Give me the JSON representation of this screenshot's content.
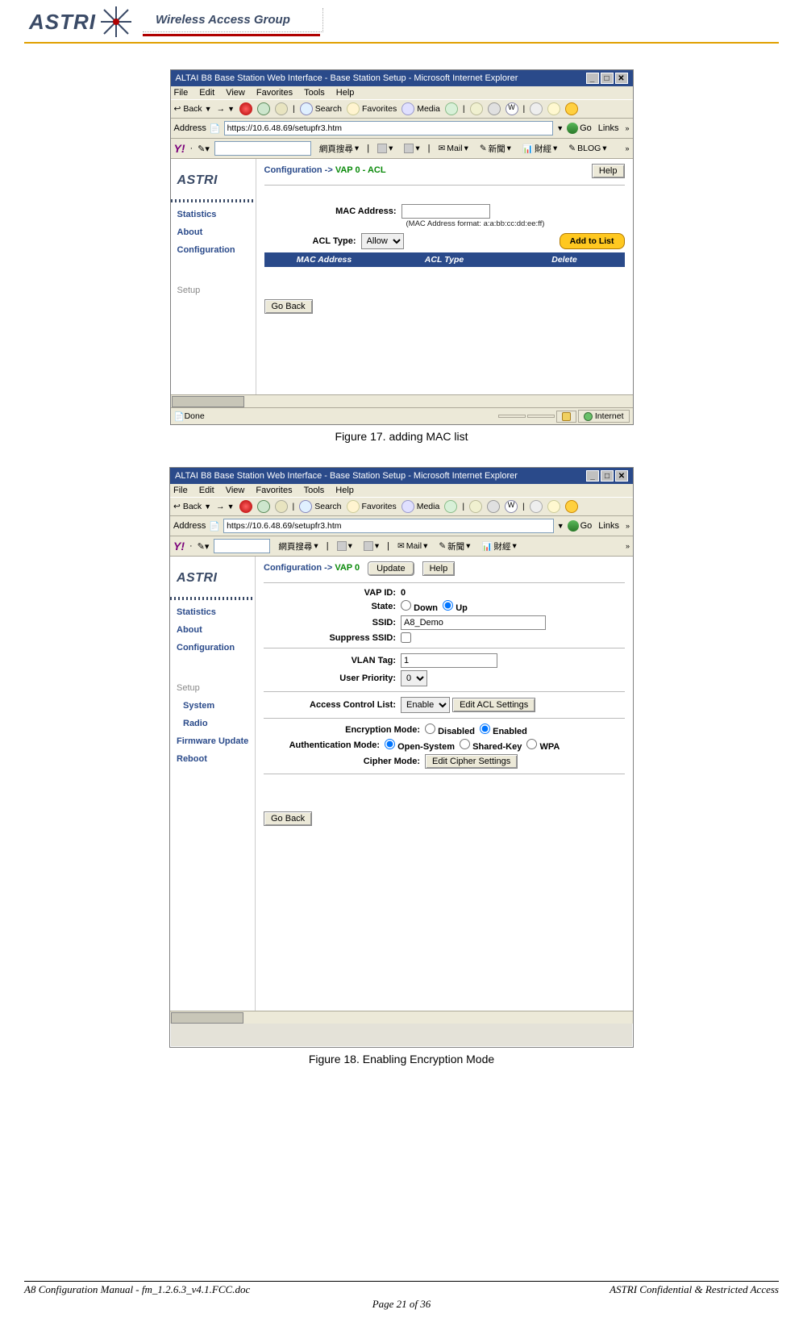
{
  "header": {
    "logo_text": "ASTRI",
    "wag_label": "Wireless Access Group"
  },
  "fig17": {
    "title": "ALTAI B8 Base Station Web Interface - Base Station Setup - Microsoft Internet Explorer",
    "menu": {
      "file": "File",
      "edit": "Edit",
      "view": "View",
      "favorites": "Favorites",
      "tools": "Tools",
      "help": "Help"
    },
    "toolbar": {
      "back": "Back",
      "search": "Search",
      "favorites": "Favorites",
      "media": "Media"
    },
    "address_label": "Address",
    "url": "https://10.6.48.69/setupfr3.htm",
    "go": "Go",
    "links": "Links",
    "yahoo": {
      "search": "網頁搜尋",
      "mail": "Mail",
      "news": "新聞",
      "fin": "財經",
      "blog": "BLOG"
    },
    "config_prefix": "Configuration ->",
    "config_page": "VAP 0 - ACL",
    "help": "Help",
    "mac_label": "MAC Address:",
    "mac_value": "",
    "mac_hint": "(MAC Address format: a:a:bb:cc:dd:ee:ff)",
    "acl_type_label": "ACL Type:",
    "acl_type_value": "Allow",
    "add_btn": "Add to List",
    "tbl": {
      "col1": "MAC Address",
      "col2": "ACL Type",
      "col3": "Delete"
    },
    "go_back": "Go Back",
    "sidebar": {
      "statistics": "Statistics",
      "about": "About",
      "configuration": "Configuration",
      "setup": "Setup"
    },
    "status_done": "Done",
    "status_net": "Internet",
    "caption": "Figure 17. adding MAC list"
  },
  "fig18": {
    "title": "ALTAI B8 Base Station Web Interface - Base Station Setup - Microsoft Internet Explorer",
    "menu": {
      "file": "File",
      "edit": "Edit",
      "view": "View",
      "favorites": "Favorites",
      "tools": "Tools",
      "help": "Help"
    },
    "toolbar": {
      "back": "Back",
      "search": "Search",
      "favorites": "Favorites",
      "media": "Media"
    },
    "address_label": "Address",
    "url": "https://10.6.48.69/setupfr3.htm",
    "go": "Go",
    "links": "Links",
    "yahoo": {
      "search": "網頁搜尋",
      "mail": "Mail",
      "news": "新聞",
      "fin": "財經"
    },
    "config_prefix": "Configuration ->",
    "config_page": "VAP 0",
    "update": "Update",
    "help": "Help",
    "sidebar": {
      "statistics": "Statistics",
      "about": "About",
      "configuration": "Configuration",
      "setup": "Setup",
      "system": "System",
      "radio": "Radio",
      "firmware": "Firmware Update",
      "reboot": "Reboot"
    },
    "form": {
      "vap_id_label": "VAP ID:",
      "vap_id": "0",
      "state_label": "State:",
      "down": "Down",
      "up": "Up",
      "ssid_label": "SSID:",
      "ssid": "A8_Demo",
      "suppress_label": "Suppress SSID:",
      "vlan_label": "VLAN Tag:",
      "vlan": "1",
      "prio_label": "User Priority:",
      "prio": "0",
      "acl_label": "Access Control List:",
      "acl_sel": "Enable",
      "acl_btn": "Edit ACL Settings",
      "enc_mode_label": "Encryption Mode:",
      "disabled": "Disabled",
      "enabled": "Enabled",
      "auth_label": "Authentication Mode:",
      "open": "Open-System",
      "shared": "Shared-Key",
      "wpa": "WPA",
      "cipher_label": "Cipher Mode:",
      "cipher_btn": "Edit Cipher Settings"
    },
    "go_back": "Go Back",
    "caption": "Figure 18. Enabling Encryption Mode"
  },
  "footer": {
    "left": "A8 Configuration Manual - fm_1.2.6.3_v4.1.FCC.doc",
    "right": "ASTRI Confidential & Restricted Access",
    "page": "Page 21 of 36"
  }
}
